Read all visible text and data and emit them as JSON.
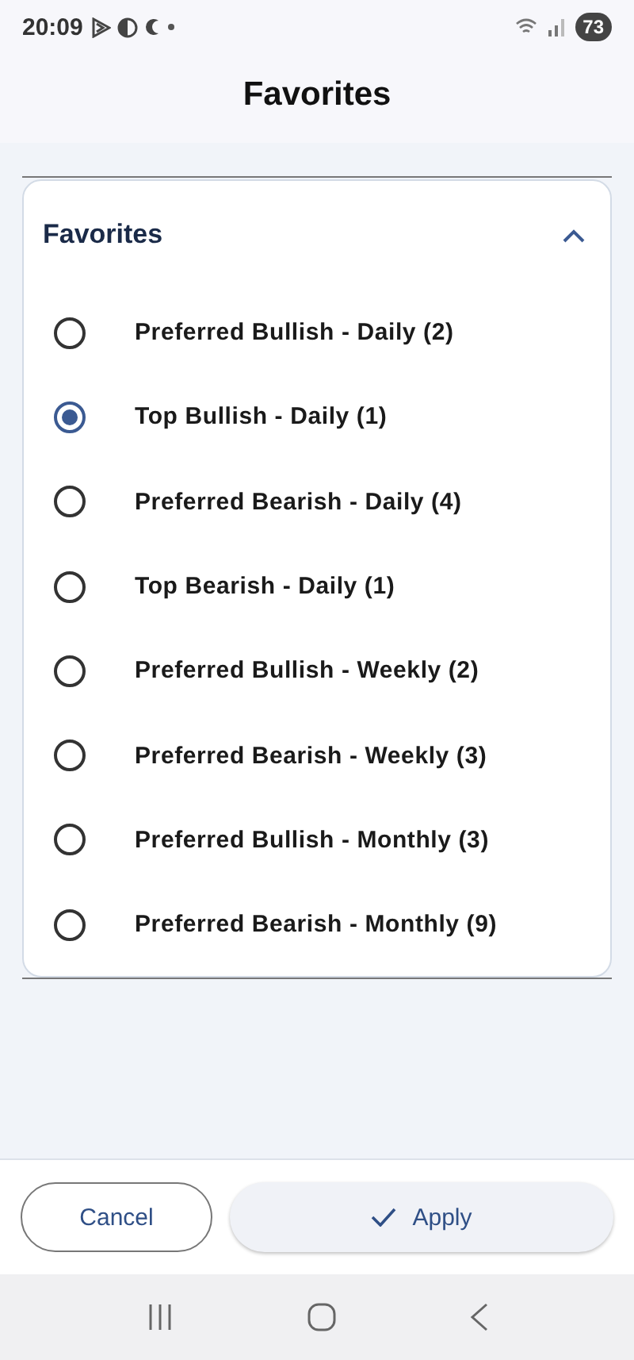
{
  "status_bar": {
    "time": "20:09",
    "battery": "73"
  },
  "header": {
    "title": "Favorites"
  },
  "section": {
    "title": "Favorites",
    "expanded": true,
    "options": [
      {
        "label": "Preferred Bullish - Daily (2)",
        "selected": false
      },
      {
        "label": "Top Bullish - Daily (1)",
        "selected": true
      },
      {
        "label": "Preferred Bearish - Daily (4)",
        "selected": false
      },
      {
        "label": "Top Bearish - Daily (1)",
        "selected": false
      },
      {
        "label": "Preferred Bullish - Weekly (2)",
        "selected": false
      },
      {
        "label": "Preferred Bearish - Weekly (3)",
        "selected": false
      },
      {
        "label": "Preferred Bullish - Monthly (3)",
        "selected": false
      },
      {
        "label": "Preferred Bearish - Monthly (9)",
        "selected": false
      }
    ]
  },
  "buttons": {
    "cancel": "Cancel",
    "apply": "Apply"
  }
}
